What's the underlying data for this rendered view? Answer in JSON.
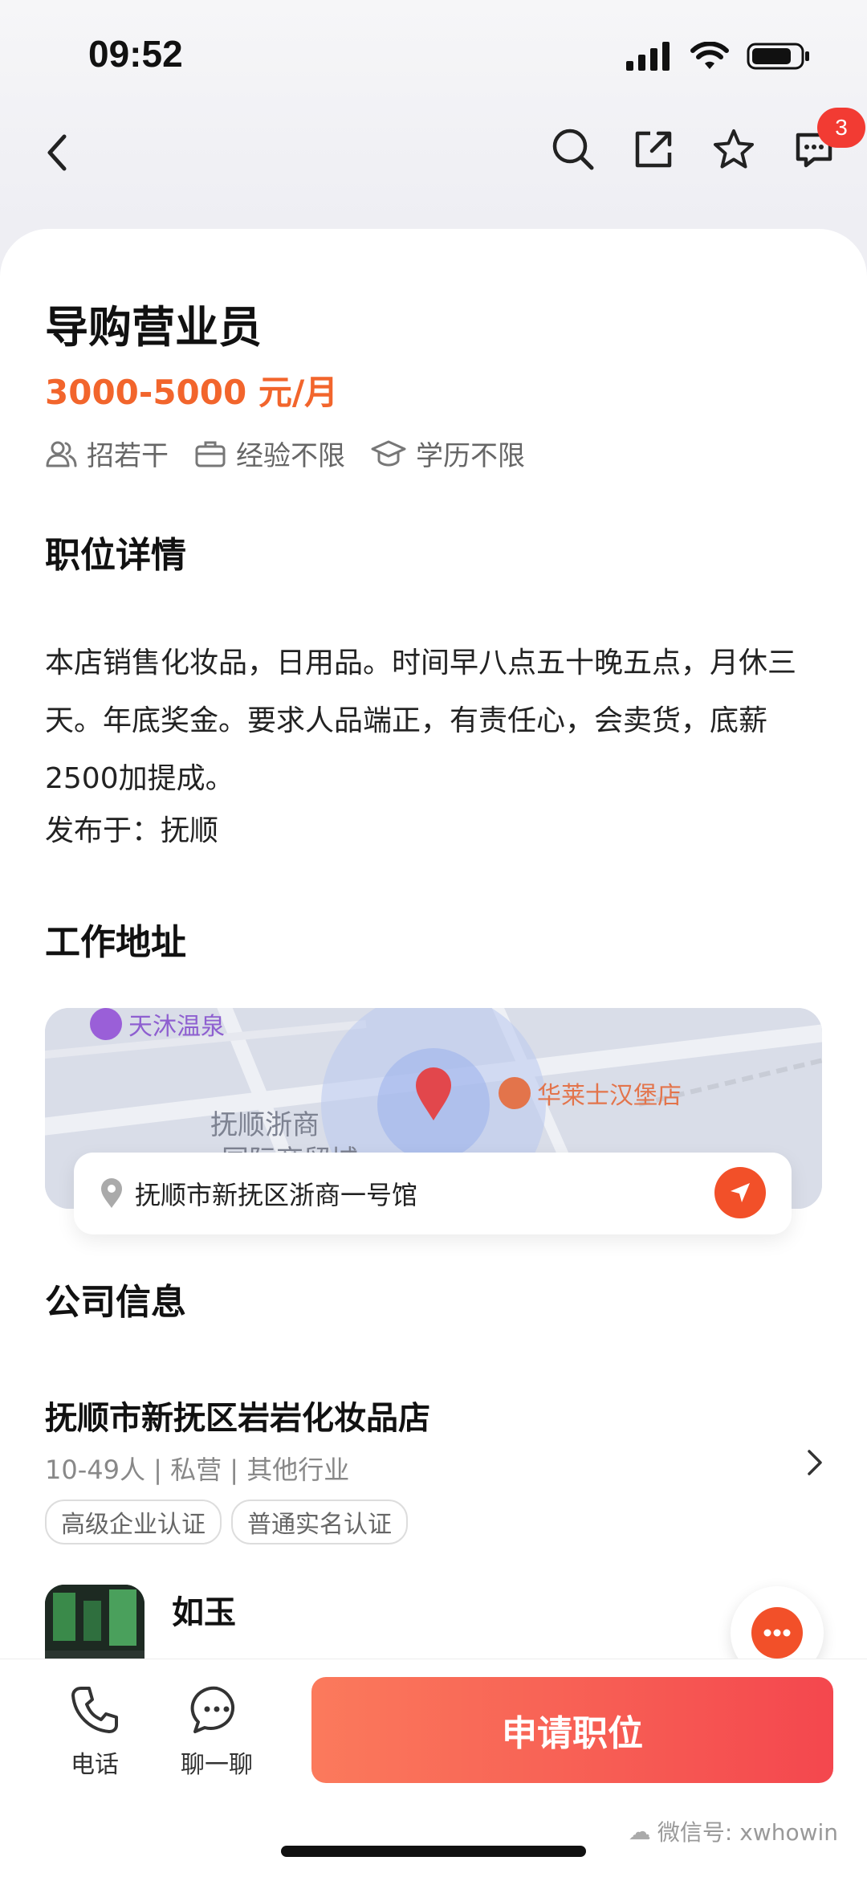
{
  "status": {
    "time": "09:52"
  },
  "nav": {
    "badge_count": "3"
  },
  "job": {
    "title": "导购营业员",
    "salary": "3000-5000 元/月",
    "tags": [
      "招若干",
      "经验不限",
      "学历不限"
    ]
  },
  "sections": {
    "detail_title": "职位详情",
    "address_title": "工作地址",
    "company_title": "公司信息"
  },
  "detail": {
    "description": "本店销售化妆品，日用品。时间早八点五十晚五点，月休三天。年底奖金。要求人品端正，有责任心，会卖货，底薪2500加提成。",
    "published": "发布于：抚顺"
  },
  "map": {
    "poi_1": "天沐温泉",
    "poi_2": "华莱士汉堡店",
    "area_label": "抚顺浙商",
    "area_label_2": "国际商贸城",
    "address": "抚顺市新抚区浙商一号馆"
  },
  "company": {
    "name": "抚顺市新抚区岩岩化妆品店",
    "meta": "10-49人 | 私营 | 其他行业",
    "certs": [
      "高级企业认证",
      "普通实名认证"
    ]
  },
  "contact": {
    "name": "如玉"
  },
  "bottom": {
    "phone_label": "电话",
    "chat_label": "聊一聊",
    "apply_label": "申请职位"
  },
  "watermark": "微信号: xwhowin",
  "colors": {
    "accent": "#f25029",
    "salary": "#f2652c"
  }
}
